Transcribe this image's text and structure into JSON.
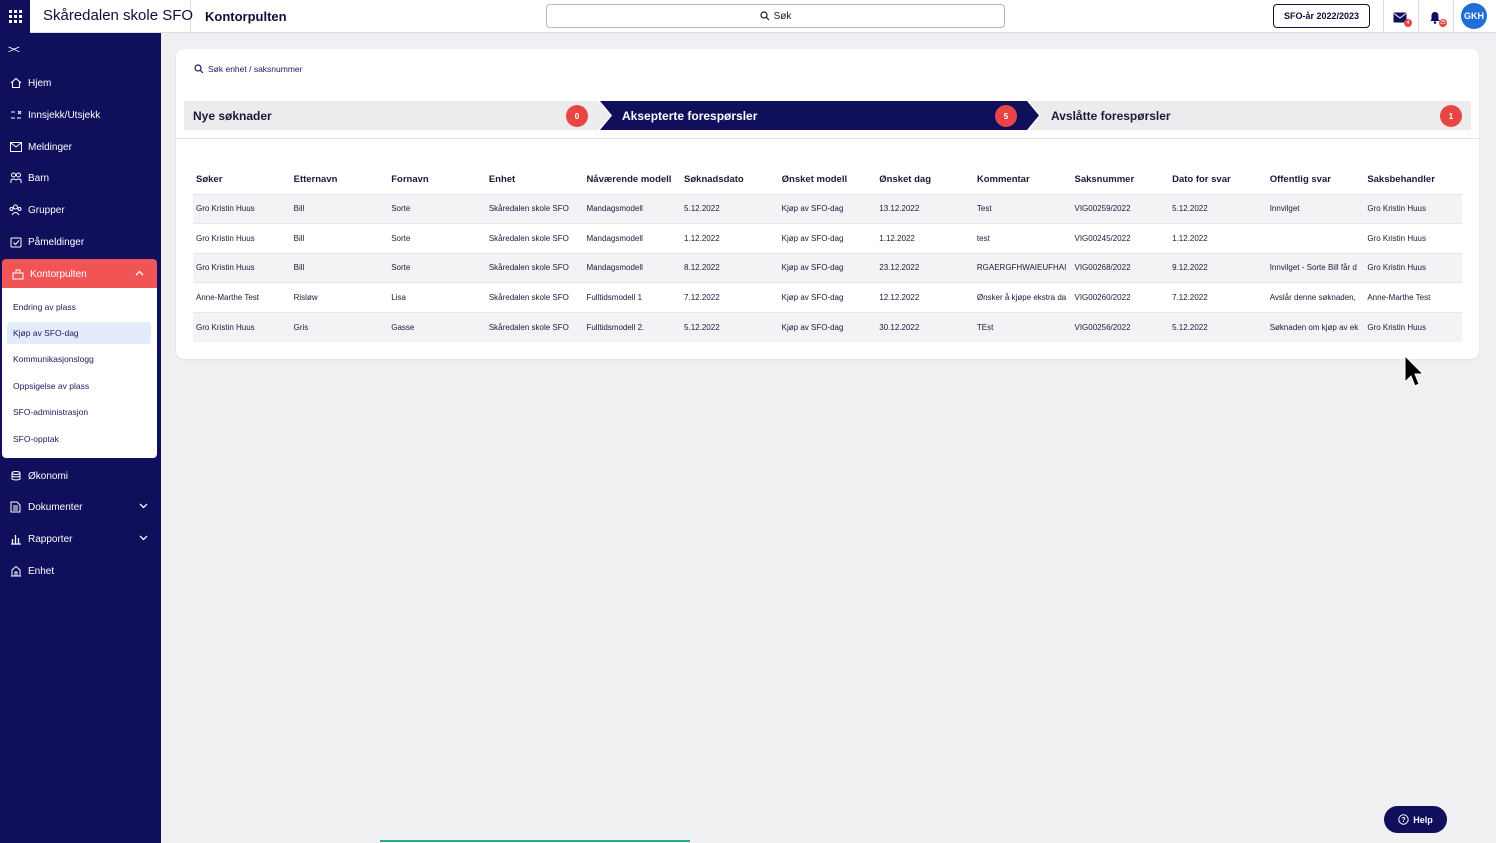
{
  "app": {
    "title": "Skåredalen skole SFO",
    "page_title": "Kontorpulten"
  },
  "search": {
    "label": "Søk"
  },
  "year_button": "SFO-år 2022/2023",
  "mail_badge": "4",
  "bell_badge": "25",
  "user_initials": "GKH",
  "sidebar": {
    "items": [
      {
        "label": "Hjem",
        "icon": "home-icon"
      },
      {
        "label": "Innsjekk/Utsjekk",
        "icon": "check-in-out-icon"
      },
      {
        "label": "Meldinger",
        "icon": "mail-icon"
      },
      {
        "label": "Barn",
        "icon": "children-icon"
      },
      {
        "label": "Grupper",
        "icon": "groups-icon"
      },
      {
        "label": "Påmeldinger",
        "icon": "registration-icon"
      },
      {
        "label": "Kontorpulten",
        "icon": "desk-icon",
        "active": true
      },
      {
        "label": "Økonomi",
        "icon": "coins-icon"
      },
      {
        "label": "Dokumenter",
        "icon": "document-icon"
      },
      {
        "label": "Rapporter",
        "icon": "bar-chart-icon"
      },
      {
        "label": "Enhet",
        "icon": "building-icon"
      }
    ],
    "submenu": [
      "Endring av plass",
      "Kjøp av SFO-dag",
      "Kommunikasjonslogg",
      "Oppsigelse av plass",
      "SFO-administrasjon",
      "SFO-opptak"
    ],
    "submenu_active": "Kjøp av SFO-dag"
  },
  "case_search": {
    "placeholder": "Søk enhet / saksnummer"
  },
  "tabs": [
    {
      "label": "Nye søknader",
      "count": "0",
      "active": false
    },
    {
      "label": "Aksepterte forespørsler",
      "count": "5",
      "active": true
    },
    {
      "label": "Avslåtte forespørsler",
      "count": "1",
      "active": false
    }
  ],
  "table": {
    "columns": [
      "Søker",
      "Etternavn",
      "Fornavn",
      "Enhet",
      "Nåværende modell",
      "Søknadsdato",
      "Ønsket modell",
      "Ønsket dag",
      "Kommentar",
      "Saksnummer",
      "Dato for svar",
      "Offentlig svar",
      "Saksbehandler"
    ],
    "rows": [
      [
        "Gro Kristin Huus",
        "Bill",
        "Sorte",
        "Skåredalen skole SFO",
        "Mandagsmodell",
        "5.12.2022",
        "Kjøp av SFO-dag",
        "13.12.2022",
        "Test",
        "VIG00259/2022",
        "5.12.2022",
        "Innvilget",
        "Gro Kristin Huus"
      ],
      [
        "Gro Kristin Huus",
        "Bill",
        "Sorte",
        "Skåredalen skole SFO",
        "Mandagsmodell",
        "1.12.2022",
        "Kjøp av SFO-dag",
        "1.12.2022",
        "test",
        "VIG00245/2022",
        "1.12.2022",
        "",
        "Gro Kristin Huus"
      ],
      [
        "Gro Kristin Huus",
        "Bill",
        "Sorte",
        "Skåredalen skole SFO",
        "Mandagsmodell",
        "8.12.2022",
        "Kjøp av SFO-dag",
        "23.12.2022",
        "RGAERGFHWAIEUFHAI",
        "VIG00268/2022",
        "9.12.2022",
        "Innvilget - Sorte Bill får d",
        "Gro Kristin Huus"
      ],
      [
        "Anne-Marthe Test",
        "Risløw",
        "Lisa",
        "Skåredalen skole SFO",
        "Fulltidsmodell 1",
        "7.12.2022",
        "Kjøp av SFO-dag",
        "12.12.2022",
        "Ønsker å kjøpe ekstra da",
        "VIG00260/2022",
        "7.12.2022",
        "Avslår denne søknaden,",
        "Anne-Marthe Test"
      ],
      [
        "Gro Kristin Huus",
        "Gris",
        "Gasse",
        "Skåredalen skole SFO",
        "Fulltidsmodell 2.",
        "5.12.2022",
        "Kjøp av SFO-dag",
        "30.12.2022",
        "TEst",
        "VIG00256/2022",
        "5.12.2022",
        "Søknaden om kjøp av ek",
        "Gro Kristin Huus"
      ]
    ]
  },
  "help_button": "Help",
  "colors": {
    "navy": "#0f0f5c",
    "accent_red": "#f05454",
    "badge_red": "#e84545",
    "active_sub_bg": "#e2ecfb"
  }
}
